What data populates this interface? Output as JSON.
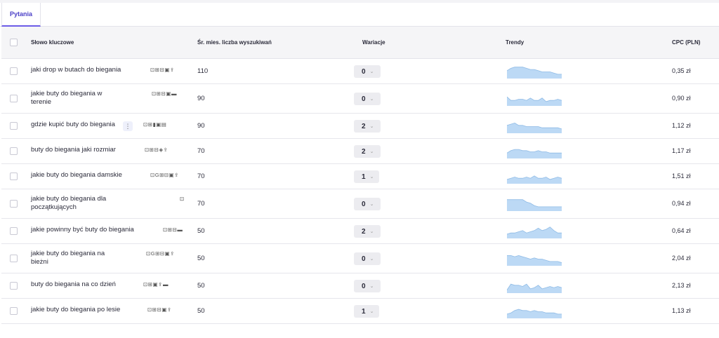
{
  "tabs": [
    {
      "label": "Pytania"
    }
  ],
  "columns": {
    "keyword": "Słowo kluczowe",
    "volume": "Śr. mies. liczba wyszukiwań",
    "variations": "Wariacje",
    "trends": "Trendy",
    "cpc": "CPC (PLN)"
  },
  "rows": [
    {
      "keyword": "jaki drop w butach do biegania",
      "features": "⊡⊞⊟▣⇪",
      "volume": "110",
      "variations": "0",
      "cpc": "0,35 zł",
      "trend": [
        6,
        8,
        9,
        9,
        9,
        8,
        7,
        7,
        6,
        5,
        5,
        5,
        4,
        3,
        3
      ]
    },
    {
      "keyword": "jakie buty do biegania w terenie",
      "features": "⊡⊞⊟▣▬",
      "volume": "90",
      "variations": "0",
      "cpc": "0,90 zł",
      "trend": [
        7,
        4,
        4,
        5,
        5,
        4,
        6,
        4,
        4,
        6,
        3,
        4,
        4,
        5,
        4
      ]
    },
    {
      "keyword": "gdzie kupić buty do biegania",
      "features": "⊡⊞▮▣▤",
      "volume": "90",
      "variations": "2",
      "cpc": "1,12 zł",
      "trend": [
        6,
        7,
        8,
        6,
        6,
        5,
        5,
        5,
        5,
        4,
        4,
        4,
        4,
        4,
        3
      ]
    },
    {
      "keyword": "buty do biegania jaki rozmiar",
      "features": "⊡⊞⊟◈⇪",
      "volume": "70",
      "variations": "2",
      "cpc": "1,17 zł",
      "trend": [
        4,
        6,
        7,
        7,
        6,
        6,
        5,
        5,
        6,
        5,
        5,
        4,
        4,
        4,
        4
      ]
    },
    {
      "keyword": "jakie buty do biegania damskie",
      "features": "⊡G⊞⊟▣⇪",
      "volume": "70",
      "variations": "1",
      "cpc": "1,51 zł",
      "trend": [
        3,
        4,
        5,
        4,
        4,
        5,
        4,
        6,
        4,
        4,
        5,
        3,
        4,
        5,
        4
      ]
    },
    {
      "keyword": "jakie buty do biegania dla początkujących",
      "features": "⊡",
      "volume": "70",
      "variations": "0",
      "cpc": "0,94 zł",
      "trend": [
        9,
        9,
        9,
        9,
        9,
        7,
        6,
        4,
        3,
        3,
        3,
        3,
        3,
        3,
        3
      ]
    },
    {
      "keyword": "jakie powinny być buty do biegania",
      "features": "⊡⊞⊟▬",
      "volume": "50",
      "variations": "2",
      "cpc": "0,64 zł",
      "trend": [
        3,
        4,
        4,
        5,
        6,
        4,
        5,
        6,
        8,
        6,
        7,
        9,
        6,
        4,
        4
      ]
    },
    {
      "keyword": "jakie buty do biegania na bieżni",
      "features": "⊡G⊞⊟▣⇪",
      "volume": "50",
      "variations": "0",
      "cpc": "2,04 zł",
      "trend": [
        8,
        8,
        7,
        8,
        7,
        6,
        5,
        6,
        5,
        5,
        4,
        3,
        3,
        3,
        2
      ]
    },
    {
      "keyword": "buty do biegania na co dzień",
      "features": "⊡⊞▣⇪▬",
      "volume": "50",
      "variations": "0",
      "cpc": "2,13 zł",
      "trend": [
        2,
        7,
        6,
        6,
        5,
        7,
        3,
        4,
        6,
        3,
        4,
        5,
        4,
        5,
        4
      ]
    },
    {
      "keyword": "jakie buty do biegania po lesie",
      "features": "⊡⊞⊟▣⇪",
      "volume": "50",
      "variations": "1",
      "cpc": "1,13 zł",
      "trend": [
        3,
        4,
        6,
        7,
        6,
        6,
        5,
        6,
        5,
        5,
        4,
        4,
        4,
        3,
        3
      ]
    }
  ],
  "colors": {
    "accent": "#6c5ce7",
    "trend_fill": "#bcd9f5",
    "trend_line": "#8fbbe6"
  }
}
